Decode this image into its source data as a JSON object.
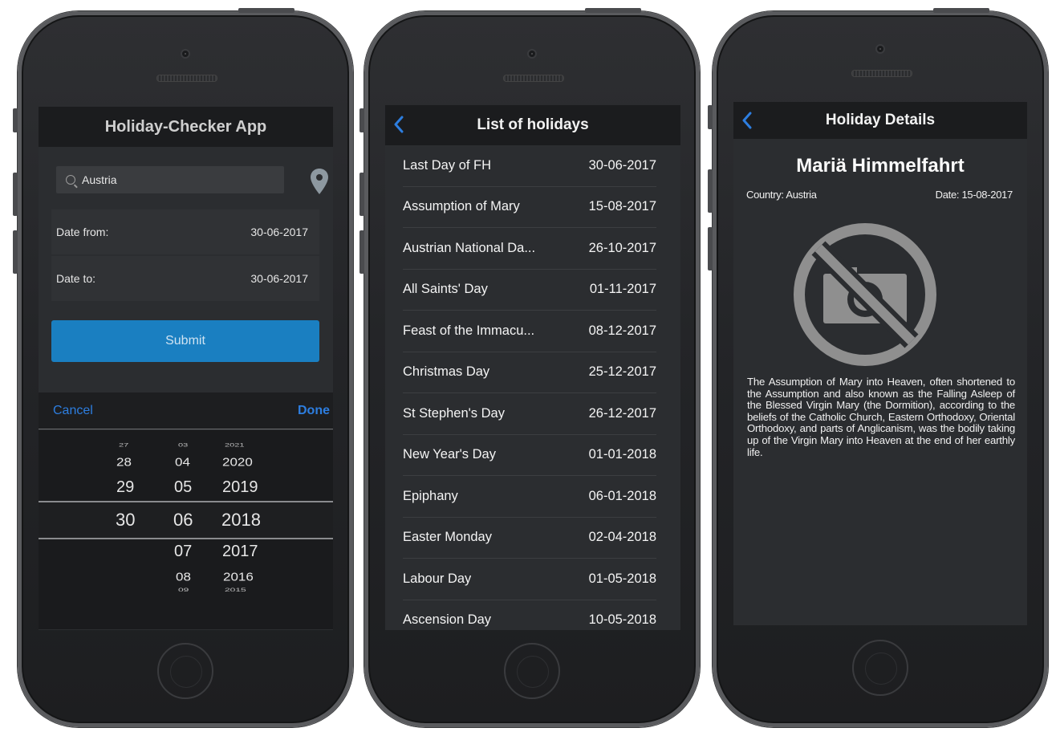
{
  "screen1": {
    "title": "Holiday-Checker App",
    "search_value": "Austria",
    "date_from_label": "Date from:",
    "date_from_value": "30-06-2017",
    "date_to_label": "Date to:",
    "date_to_value": "30-06-2017",
    "submit_label": "Submit",
    "cancel_label": "Cancel",
    "done_label": "Done",
    "picker": {
      "days": [
        "27",
        "28",
        "29",
        "30"
      ],
      "months": [
        "03",
        "04",
        "05",
        "06",
        "07",
        "08",
        "09"
      ],
      "years": [
        "2021",
        "2020",
        "2019",
        "2018",
        "2017",
        "2016",
        "2015"
      ]
    }
  },
  "screen2": {
    "title": "List of holidays",
    "holidays": [
      {
        "name": "Last Day of FH",
        "date": "30-06-2017"
      },
      {
        "name": "Assumption of Mary",
        "date": "15-08-2017"
      },
      {
        "name": "Austrian National Da...",
        "date": "26-10-2017"
      },
      {
        "name": "All Saints' Day",
        "date": "01-11-2017"
      },
      {
        "name": "Feast of the Immacu...",
        "date": "08-12-2017"
      },
      {
        "name": "Christmas Day",
        "date": "25-12-2017"
      },
      {
        "name": "St Stephen's Day",
        "date": "26-12-2017"
      },
      {
        "name": "New Year's Day",
        "date": "01-01-2018"
      },
      {
        "name": "Epiphany",
        "date": "06-01-2018"
      },
      {
        "name": "Easter Monday",
        "date": "02-04-2018"
      },
      {
        "name": "Labour Day",
        "date": "01-05-2018"
      },
      {
        "name": "Ascension Day",
        "date": "10-05-2018"
      }
    ]
  },
  "screen3": {
    "title": "Holiday Details",
    "holiday_name": "Mariä Himmelfahrt",
    "country": "Country: Austria",
    "date": "Date: 15-08-2017",
    "image_icon": "no-image-icon",
    "description": "The Assumption of Mary into Heaven, often shortened to the Assumption and also known as the Falling Asleep of the Blessed Virgin Mary (the Dormition), according to the beliefs of the Catholic Church, Eastern Orthodoxy, Oriental Orthodoxy, and parts of Anglicanism, was the bodily taking up of the Virgin Mary into Heaven at the end of her earthly life."
  },
  "colors": {
    "accent": "#1a7fc1",
    "link": "#2d7ee0",
    "background": "#2b2d30",
    "header": "#1b1c1e"
  }
}
